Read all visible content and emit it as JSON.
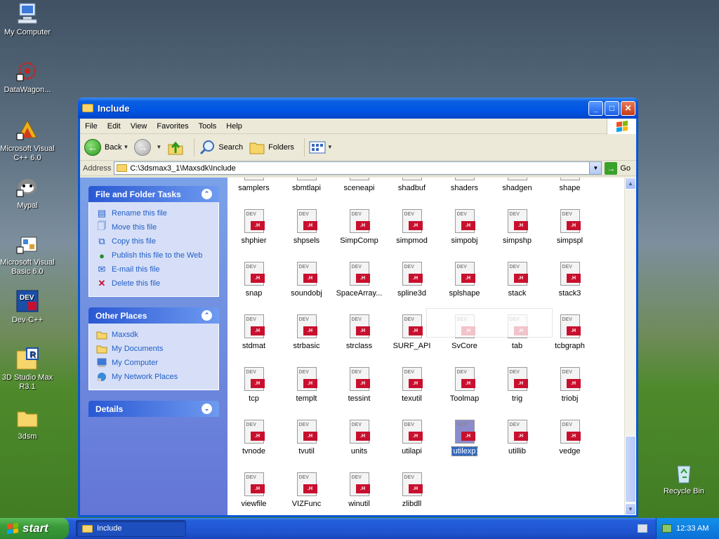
{
  "desktop": {
    "icons": [
      {
        "label": "My Computer"
      },
      {
        "label": "DataWagon..."
      },
      {
        "label": "Microsoft Visual C++ 6.0"
      },
      {
        "label": "Mypal"
      },
      {
        "label": "Microsoft Visual Basic 6.0"
      },
      {
        "label": "Dev-C++"
      },
      {
        "label": "3D Studio Max R3.1"
      },
      {
        "label": "3dsm"
      },
      {
        "label": "Recycle Bin"
      }
    ]
  },
  "window": {
    "title": "Include",
    "controls": {
      "minimize": "_",
      "maximize": "□",
      "close": "✕"
    },
    "menu": [
      "File",
      "Edit",
      "View",
      "Favorites",
      "Tools",
      "Help"
    ],
    "toolbar": {
      "back": "Back",
      "search": "Search",
      "folders": "Folders"
    },
    "address": {
      "label": "Address",
      "value": "C:\\3dsmax3_1\\Maxsdk\\Include",
      "go": "Go"
    }
  },
  "taskpane": {
    "file_tasks": {
      "title": "File and Folder Tasks",
      "items": [
        {
          "label": "Rename this file",
          "icon": "rename-icon"
        },
        {
          "label": "Move this file",
          "icon": "move-icon"
        },
        {
          "label": "Copy this file",
          "icon": "copy-icon"
        },
        {
          "label": "Publish this file to the Web",
          "icon": "globe-icon"
        },
        {
          "label": "E-mail this file",
          "icon": "email-icon"
        },
        {
          "label": "Delete this file",
          "icon": "delete-icon"
        }
      ]
    },
    "other_places": {
      "title": "Other Places",
      "items": [
        {
          "label": "Maxsdk",
          "icon": "folder-icon"
        },
        {
          "label": "My Documents",
          "icon": "folder-icon"
        },
        {
          "label": "My Computer",
          "icon": "computer-icon"
        },
        {
          "label": "My Network Places",
          "icon": "network-icon"
        }
      ]
    },
    "details": {
      "title": "Details"
    }
  },
  "files": [
    "samplers",
    "sbmtlapi",
    "sceneapi",
    "shadbuf",
    "shaders",
    "shadgen",
    "shape",
    "shphier",
    "shpsels",
    "SimpComp",
    "simpmod",
    "simpobj",
    "simpshp",
    "simpspl",
    "snap",
    "soundobj",
    "SpaceArray...",
    "spline3d",
    "splshape",
    "stack",
    "stack3",
    "stdmat",
    "strbasic",
    "strclass",
    "SURF_API",
    "SvCore",
    "tab",
    "tcbgraph",
    "tcp",
    "templt",
    "tessint",
    "texutil",
    "Toolmap",
    "trig",
    "triobj",
    "tvnode",
    "tvutil",
    "units",
    "utilapi",
    "utilexp",
    "utillib",
    "vedge",
    "viewfile",
    "VIZFunc",
    "winutil",
    "zlibdll"
  ],
  "selected_file": "utilexp",
  "file_badge": ".H",
  "file_watermark": "DEV",
  "taskbar": {
    "start": "start",
    "window_button": "Include",
    "clock": "12:33 AM"
  },
  "colors": {
    "xp_blue": "#0a57d6",
    "taskpane": "#6375d6",
    "link": "#215dc6",
    "h_badge": "#c8102e",
    "start_green": "#3a9a3a"
  }
}
